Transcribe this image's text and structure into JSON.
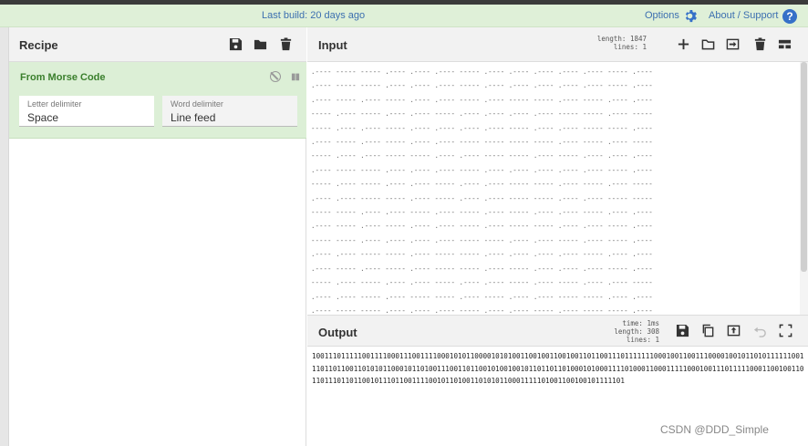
{
  "banner": {
    "build_text": "Last build: 20 days ago",
    "options_label": "Options",
    "options_icon": "gear-icon",
    "about_label": "About / Support",
    "help_icon": "question-circle-icon"
  },
  "recipe": {
    "title": "Recipe",
    "icons": [
      "save-icon",
      "folder-icon",
      "trash-icon"
    ],
    "operation": {
      "name": "From Morse Code",
      "letter_delimiter_label": "Letter delimiter",
      "letter_delimiter_value": "Space",
      "word_delimiter_label": "Word delimiter",
      "word_delimiter_value": "Line feed"
    }
  },
  "input": {
    "title": "Input",
    "length_label": "length:",
    "length_value": "1847",
    "lines_label": "lines:",
    "lines_value": "1",
    "rows": [
      ".---- ----- ----- .---- .---- .---- ----- .---- .---- .---- .---- .---- ----- .----",
      ".---- ----- ----- .---- .---- .---- ----- .---- .---- .---- .---- .---- ----- .----",
      ".---- ----- .---- ----- .---- .---- ----- .---- ----- ----- .---- ----- .---- .----",
      "----- .---- ----- .---- .---- ----- .---- .---- .---- .---- ----- ----- .---- -----",
      "----- .---- .---- ----- .---- .---- .---- .---- ----- .---- .---- ----- ----- .----",
      ".---- ----- .---- ----- .---- .---- ----- ----- ----- ----- .---- ----- .---- -----",
      "----- .---- .---- ----- ----- .---- .---- ----- ----- .---- ----- .---- .---- .----",
      ".---- ----- ----- .---- .---- .---- ----- .---- .---- .---- .---- .---- ----- .----",
      "----- .---- ----- .---- .---- ----- .---- .---- ----- ----- .---- ----- .---- -----",
      ".---- .---- ----- ----- .---- ----- .---- .---- ----- ----- .---- .---- ----- -----",
      "----- ----- .---- .---- ----- .---- ----- .---- ----- .---- .---- ----- .---- .----",
      ".---- ----- .---- ----- .---- .---- ----- .---- ----- ----- .---- .---- ----- .----",
      "----- ----- .---- .---- .---- .---- ----- ----- .---- .---- ----- .---- ----- .----",
      ".---- .---- ----- ----- .---- ----- ----- .---- .---- .---- .---- ----- .---- .----",
      ".---- ----- .---- ----- .---- ----- ----- .---- ----- .---- .---- .---- ----- .----",
      "----- .---- ----- .---- .---- ----- .---- .---- ----- .---- ----- .---- .---- -----",
      ".---- .---- ----- .---- ----- ----- .---- ----- .---- .---- ----- ----- .---- .----",
      ".---- ----- ----- .---- .---- .---- ----- .---- .---- ----- .---- ----- ----- .----"
    ]
  },
  "output": {
    "title": "Output",
    "time_label": "time:",
    "time_value": "1ms",
    "length_label": "length:",
    "length_value": "308",
    "lines_label": "lines:",
    "lines_value": "1",
    "text": "10011101111100111100011100111100010101100001010100110010011001001101100111011111110001001100111000010010110101111110011101101100110101011000101101001110011011001010010010110110110100010100011110100011000111110001001110111110001100100110110111011011001011101100111100101101001101010110001111101001100100101111101"
  },
  "watermark": "CSDN @DDD_Simple"
}
